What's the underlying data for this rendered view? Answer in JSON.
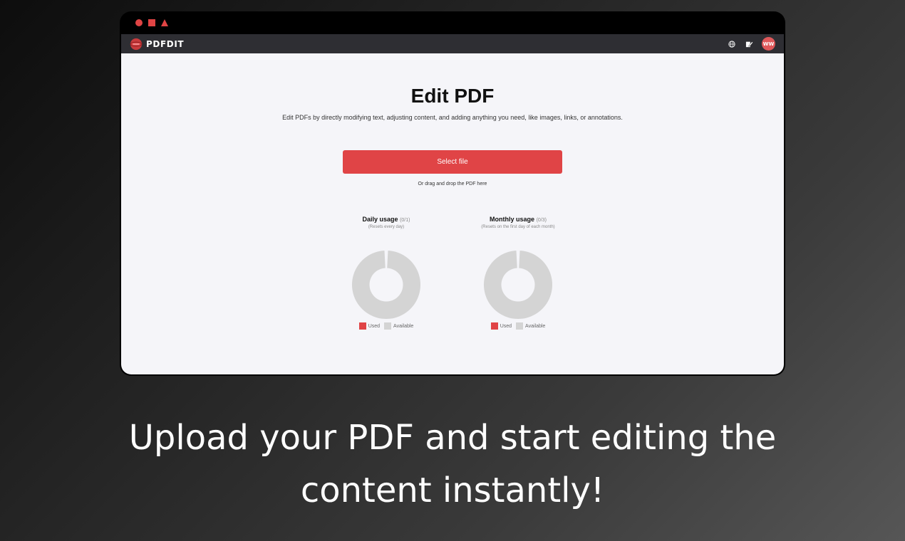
{
  "app": {
    "name": "PDFDIT",
    "avatar_initials": "WW"
  },
  "nav": {
    "icons": [
      "globe-icon",
      "edit-icon"
    ]
  },
  "page": {
    "title": "Edit PDF",
    "description": "Edit PDFs by directly modifying text, adjusting content, and adding anything you need, like images, links, or annotations.",
    "select_button": "Select file",
    "drag_hint": "Or drag and drop the PDF here"
  },
  "usage": {
    "daily": {
      "title": "Daily usage",
      "count": "(0/1)",
      "subtitle": "(Resets every day)",
      "used": 0,
      "limit": 1
    },
    "monthly": {
      "title": "Monthly usage",
      "count": "(0/3)",
      "subtitle": "(Resets on the first day of each month)",
      "used": 0,
      "limit": 3
    },
    "legend_used": "Used",
    "legend_available": "Available"
  },
  "colors": {
    "accent": "#e04446",
    "available": "#d4d4d4",
    "navbar": "#2e2e33"
  },
  "caption": {
    "line1": "Upload your PDF and start editing the",
    "line2": "content instantly!"
  }
}
